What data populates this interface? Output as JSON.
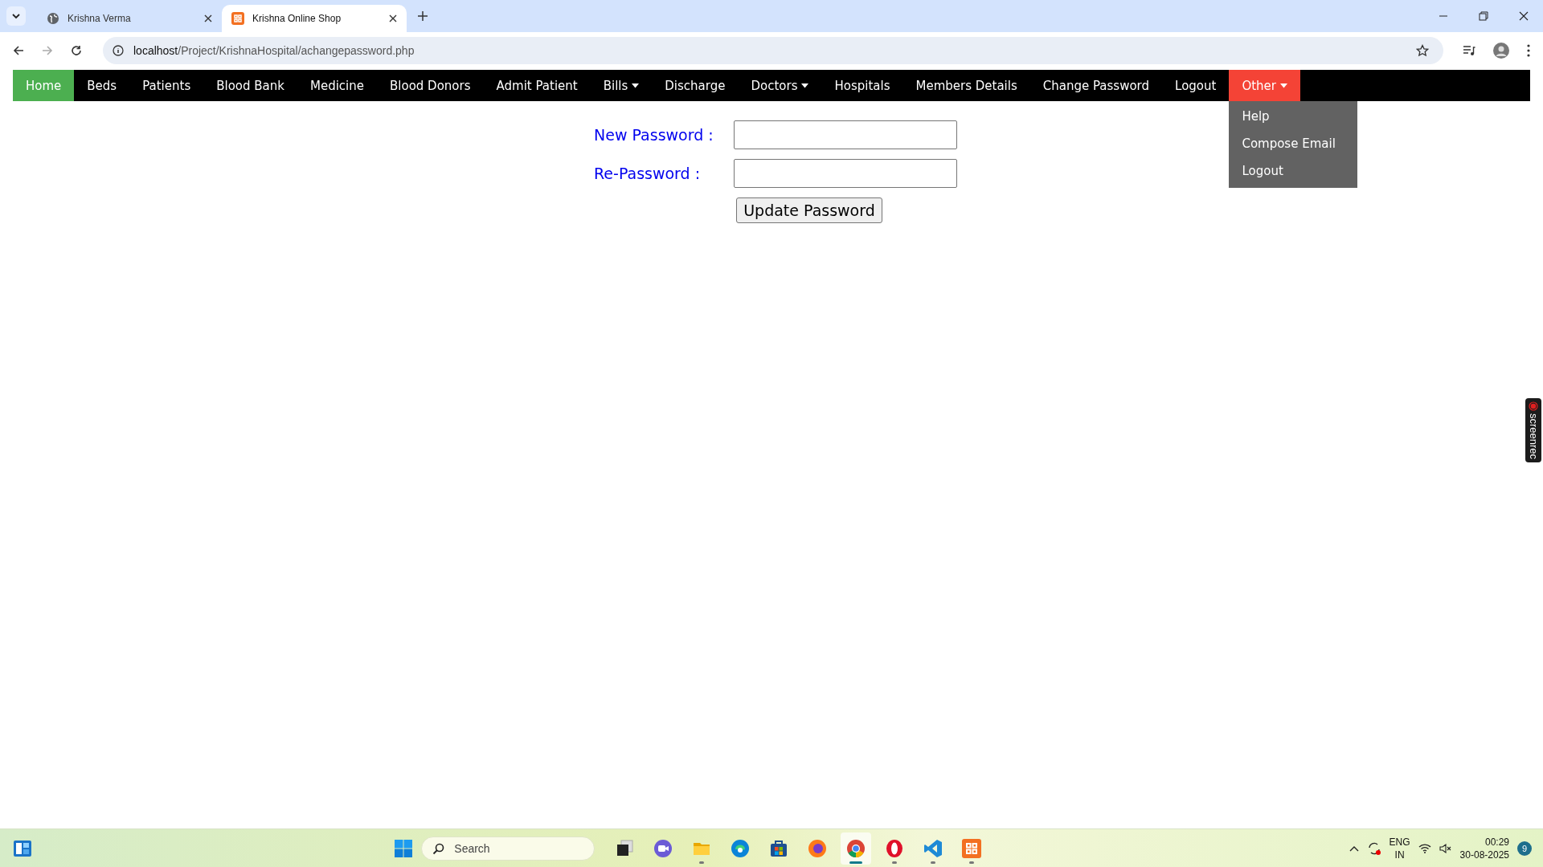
{
  "browser": {
    "tabs": [
      {
        "title": "Krishna Verma",
        "selected": false,
        "kind": "globe"
      },
      {
        "title": "Krishna Online Shop",
        "selected": true,
        "kind": "xampp"
      }
    ],
    "address": {
      "host": "localhost",
      "path": "/Project/KrishnaHospital/achangepassword.php"
    }
  },
  "nav": {
    "items": [
      {
        "label": "Home",
        "selected": true,
        "has_menu": false,
        "expanded": false
      },
      {
        "label": "Beds",
        "selected": false,
        "has_menu": false,
        "expanded": false
      },
      {
        "label": "Patients",
        "selected": false,
        "has_menu": false,
        "expanded": false
      },
      {
        "label": "Blood Bank",
        "selected": false,
        "has_menu": false,
        "expanded": false
      },
      {
        "label": "Medicine",
        "selected": false,
        "has_menu": false,
        "expanded": false
      },
      {
        "label": "Blood Donors",
        "selected": false,
        "has_menu": false,
        "expanded": false
      },
      {
        "label": "Admit Patient",
        "selected": false,
        "has_menu": false,
        "expanded": false
      },
      {
        "label": "Bills",
        "selected": false,
        "has_menu": true,
        "expanded": false
      },
      {
        "label": "Discharge",
        "selected": false,
        "has_menu": false,
        "expanded": false
      },
      {
        "label": "Doctors",
        "selected": false,
        "has_menu": true,
        "expanded": false
      },
      {
        "label": "Hospitals",
        "selected": false,
        "has_menu": false,
        "expanded": false
      },
      {
        "label": "Members Details",
        "selected": false,
        "has_menu": false,
        "expanded": false
      },
      {
        "label": "Change Password",
        "selected": false,
        "has_menu": false,
        "expanded": false
      },
      {
        "label": "Logout",
        "selected": false,
        "has_menu": false,
        "expanded": false
      },
      {
        "label": "Other",
        "selected": false,
        "has_menu": true,
        "expanded": true,
        "menu": [
          "Help",
          "Compose Email",
          "Logout"
        ]
      }
    ]
  },
  "form": {
    "fields": [
      {
        "label": "New Password :"
      },
      {
        "label": "Re-Password :"
      }
    ],
    "button": "Update Password"
  },
  "screenrec": {
    "label": "screenrec"
  },
  "taskbar": {
    "search": {
      "placeholder": "Search"
    },
    "apps": [
      {
        "kind": "taskview",
        "running": false,
        "selected": false
      },
      {
        "kind": "meet",
        "running": false,
        "selected": false
      },
      {
        "kind": "folder",
        "running": true,
        "selected": false
      },
      {
        "kind": "edge",
        "running": false,
        "selected": false
      },
      {
        "kind": "store",
        "running": false,
        "selected": false
      },
      {
        "kind": "firefox",
        "running": false,
        "selected": false
      },
      {
        "kind": "chrome",
        "running": true,
        "selected": true
      },
      {
        "kind": "opera",
        "running": true,
        "selected": false
      },
      {
        "kind": "vscode",
        "running": true,
        "selected": false
      },
      {
        "kind": "xampp",
        "running": true,
        "selected": false
      }
    ],
    "tray": {
      "lang": "ENG",
      "region": "IN",
      "time": "00:29",
      "date": "30-08-2025",
      "badge": "9"
    }
  }
}
